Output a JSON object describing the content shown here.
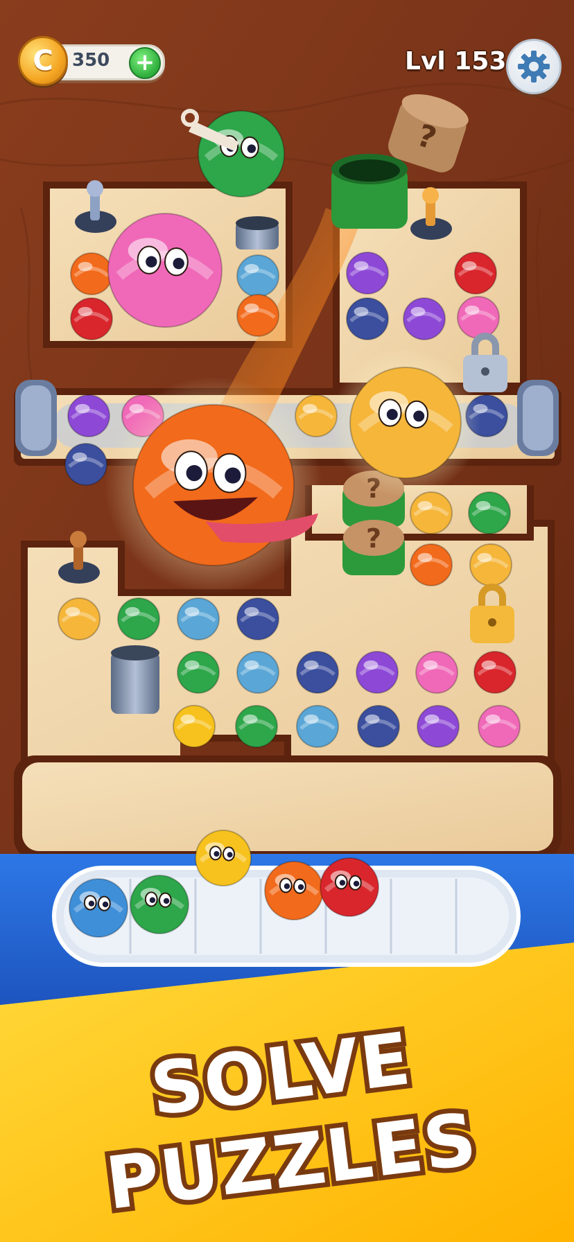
{
  "hud": {
    "coin_symbol": "C",
    "coins": "350",
    "add_coins_symbol": "+",
    "level": "Lvl 153",
    "settings_icon": "gear-icon"
  },
  "board": {
    "cork_symbol": "?"
  },
  "promo": {
    "line1": "SOLVE",
    "line2": "PUZZLES"
  },
  "colors": {
    "wood_dark": "#7a3419",
    "board_light": "#f2d7ae",
    "tray_blue": "#1f5fcf",
    "banner_yellow": "#ffc51a",
    "coin_gold": "#f5a623",
    "plus_green": "#2eae3c"
  }
}
